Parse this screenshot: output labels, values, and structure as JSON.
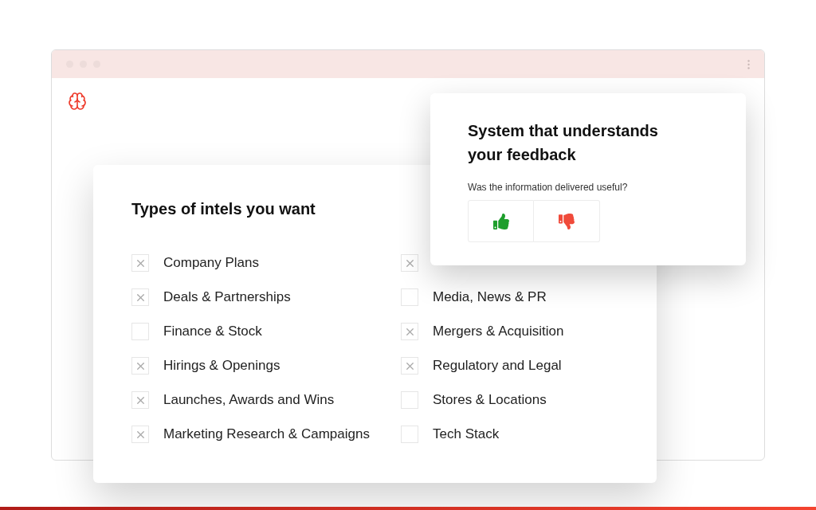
{
  "intel_card": {
    "title": "Types of intels you want",
    "columns": [
      [
        {
          "label": "Company Plans",
          "checked": true
        },
        {
          "label": "Deals & Partnerships",
          "checked": true
        },
        {
          "label": "Finance & Stock",
          "checked": false
        },
        {
          "label": "Hirings & Openings",
          "checked": true
        },
        {
          "label": "Launches, Awards and Wins",
          "checked": true
        },
        {
          "label": "Marketing Research & Campaigns",
          "checked": true
        }
      ],
      [
        {
          "checked": true
        },
        {
          "label": "Media, News & PR",
          "checked": false
        },
        {
          "label": "Mergers & Acquisition",
          "checked": true
        },
        {
          "label": "Regulatory and Legal",
          "checked": true
        },
        {
          "label": "Stores & Locations",
          "checked": false
        },
        {
          "label": "Tech Stack",
          "checked": false
        }
      ]
    ]
  },
  "feedback_card": {
    "title": "System that understands your feedback",
    "question": "Was the information delivered useful?",
    "buttons": [
      {
        "kind": "up"
      },
      {
        "kind": "down"
      }
    ]
  }
}
